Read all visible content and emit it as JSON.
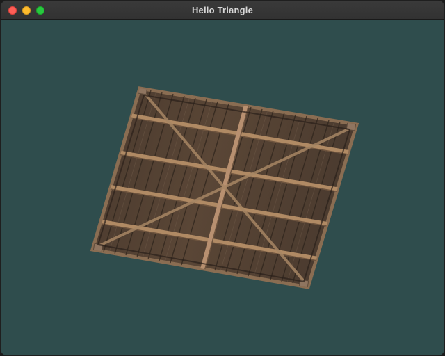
{
  "window": {
    "title": "Hello Triangle",
    "controls": {
      "close_color": "#ff5f57",
      "minimize_color": "#febc2e",
      "maximize_color": "#28c840"
    }
  },
  "viewport": {
    "clear_color": "#2f4d4d",
    "texture": "wooden-crate-texture"
  }
}
